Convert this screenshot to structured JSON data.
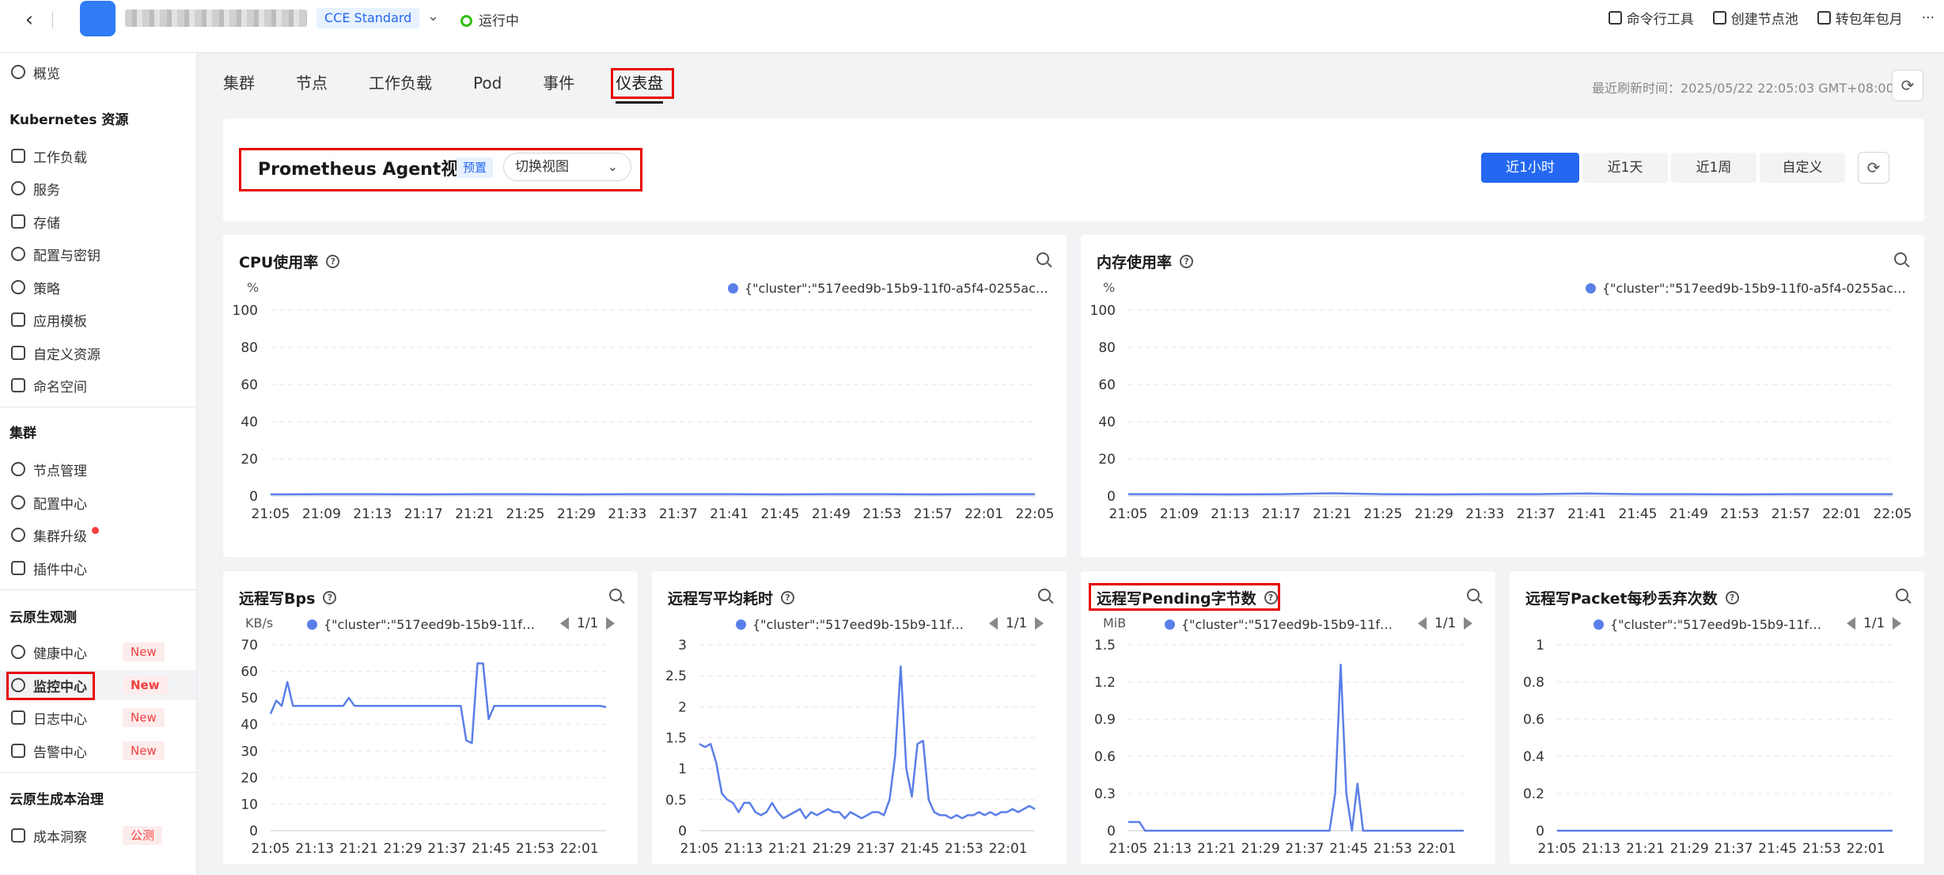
{
  "topbar": {
    "edition_badge": "CCE Standard",
    "status": "运行中",
    "actions": [
      {
        "label": "命令行工具",
        "icon": "terminal-icon"
      },
      {
        "label": "创建节点池",
        "icon": "node-pool-icon"
      },
      {
        "label": "转包年包月",
        "icon": "calendar-icon"
      },
      {
        "label": "···",
        "icon": "more-icon"
      }
    ]
  },
  "sidebar": {
    "overview": "概览",
    "k8s_header": "Kubernetes 资源",
    "k8s_items": [
      "工作负载",
      "服务",
      "存储",
      "配置与密钥",
      "策略",
      "应用模板",
      "自定义资源",
      "命名空间"
    ],
    "cluster_header": "集群",
    "cluster_items": [
      "节点管理",
      "配置中心",
      "集群升级",
      "插件中心"
    ],
    "obs_header": "云原生观测",
    "obs_items": [
      "健康中心",
      "监控中心",
      "日志中心",
      "告警中心"
    ],
    "new_badge": "New",
    "cost_header": "云原生成本治理",
    "cost_items": [
      "成本洞察"
    ],
    "beta_badge": "公测"
  },
  "tabs": [
    "集群",
    "节点",
    "工作负载",
    "Pod",
    "事件",
    "仪表盘"
  ],
  "active_tab": "仪表盘",
  "refresh_time": "最近刷新时间：2025/05/22 22:05:03 GMT+08:00",
  "dashboard": {
    "title": "Prometheus Agent视图",
    "preset_badge": "预置",
    "switch_view": "切换视图",
    "time_ranges": [
      "近1小时",
      "近1天",
      "近1周",
      "自定义"
    ],
    "active_range": "近1小时"
  },
  "legend_label": "{\"cluster\":\"517eed9b-15b9-11f0-a5f4-0255ac10...",
  "legend_label_short": "{\"cluster\":\"517eed9b-15b9-11f0-a5f4",
  "pager": "1/1",
  "colors": {
    "accent": "#2468f2",
    "series": "#5b7fe8",
    "highlight": "#e80000"
  },
  "chart_data": [
    {
      "id": "cpu",
      "type": "line",
      "title": "CPU使用率",
      "unit": "%",
      "ylim": [
        0,
        100
      ],
      "yticks": [
        "100",
        "80",
        "60",
        "40",
        "20",
        "0"
      ],
      "xticks": [
        "21:05",
        "21:09",
        "21:13",
        "21:17",
        "21:21",
        "21:25",
        "21:29",
        "21:33",
        "21:37",
        "21:41",
        "21:45",
        "21:49",
        "21:53",
        "21:57",
        "22:01",
        "22:05"
      ],
      "series": [
        {
          "name": "{\"cluster\":\"517eed9b-15b9-11f0-a5f4-0255ac10...",
          "values": [
            0.9,
            1,
            1,
            0.9,
            1,
            1,
            0.9,
            1,
            1,
            1,
            0.9,
            1,
            1,
            0.9,
            1,
            1
          ]
        }
      ]
    },
    {
      "id": "mem",
      "type": "line",
      "title": "内存使用率",
      "unit": "%",
      "ylim": [
        0,
        100
      ],
      "yticks": [
        "100",
        "80",
        "60",
        "40",
        "20",
        "0"
      ],
      "xticks": [
        "21:05",
        "21:09",
        "21:13",
        "21:17",
        "21:21",
        "21:25",
        "21:29",
        "21:33",
        "21:37",
        "21:41",
        "21:45",
        "21:49",
        "21:53",
        "21:57",
        "22:01",
        "22:05"
      ],
      "series": [
        {
          "name": "{\"cluster\":\"517eed9b-15b9-11f0-a5f4-0255ac10...",
          "values": [
            1,
            1,
            0.9,
            1,
            1.5,
            1,
            0.9,
            1,
            1,
            1.4,
            1,
            1,
            0.9,
            1,
            1,
            1
          ]
        }
      ]
    },
    {
      "id": "bps",
      "type": "line",
      "title": "远程写Bps",
      "unit": "KB/s",
      "ylim": [
        0,
        70
      ],
      "yticks": [
        "70",
        "60",
        "50",
        "40",
        "30",
        "20",
        "10",
        "0"
      ],
      "xticks": [
        "21:05",
        "21:13",
        "21:21",
        "21:29",
        "21:37",
        "21:45",
        "21:53",
        "22:01"
      ],
      "x": [
        0,
        1,
        2,
        3,
        4,
        5,
        6,
        7,
        8,
        9,
        10,
        11,
        12,
        13,
        14,
        15,
        16,
        17,
        18,
        19,
        20,
        21,
        22,
        23,
        24,
        25,
        26,
        27,
        28,
        29,
        30,
        31,
        32,
        33,
        34,
        35,
        36,
        37,
        38,
        39,
        40,
        41,
        42,
        43,
        44,
        45,
        46,
        47,
        48,
        49,
        50,
        51,
        52,
        53,
        54,
        55,
        56,
        57,
        58,
        59,
        60
      ],
      "series": [
        {
          "name": "{\"cluster\":\"517eed9b-15b9-11f0-a5f4",
          "values": [
            44,
            49,
            47,
            56,
            47,
            47,
            47,
            47,
            47,
            47,
            47,
            47,
            47,
            47,
            50,
            47,
            47,
            47,
            47,
            47,
            47,
            47,
            47,
            47,
            47,
            47,
            47,
            47,
            47,
            47,
            47,
            47,
            47,
            47,
            47,
            34,
            33,
            63,
            63,
            42,
            47,
            47,
            47,
            47,
            47,
            47,
            47,
            47,
            47,
            47,
            47,
            47,
            47,
            47,
            47,
            47,
            47,
            47,
            47,
            47,
            46.5
          ]
        }
      ]
    },
    {
      "id": "latency",
      "type": "line",
      "title": "远程写平均耗时",
      "unit": "",
      "ylim": [
        0,
        3
      ],
      "yticks": [
        "3",
        "2.5",
        "2",
        "1.5",
        "1",
        "0.5",
        "0"
      ],
      "xticks": [
        "21:05",
        "21:13",
        "21:21",
        "21:29",
        "21:37",
        "21:45",
        "21:53",
        "22:01"
      ],
      "x": [
        0,
        1,
        2,
        3,
        4,
        5,
        6,
        7,
        8,
        9,
        10,
        11,
        12,
        13,
        14,
        15,
        16,
        17,
        18,
        19,
        20,
        21,
        22,
        23,
        24,
        25,
        26,
        27,
        28,
        29,
        30,
        31,
        32,
        33,
        34,
        35,
        36,
        37,
        38,
        39,
        40,
        41,
        42,
        43,
        44,
        45,
        46,
        47,
        48,
        49,
        50,
        51,
        52,
        53,
        54,
        55,
        56,
        57,
        58,
        59,
        60
      ],
      "series": [
        {
          "name": "{\"cluster\":\"517eed9b-15b9-11f0-a5f4",
          "values": [
            1.4,
            1.35,
            1.4,
            1.1,
            0.6,
            0.5,
            0.45,
            0.3,
            0.45,
            0.45,
            0.3,
            0.25,
            0.3,
            0.45,
            0.3,
            0.2,
            0.25,
            0.3,
            0.35,
            0.2,
            0.3,
            0.25,
            0.3,
            0.35,
            0.3,
            0.3,
            0.2,
            0.3,
            0.25,
            0.2,
            0.25,
            0.3,
            0.3,
            0.25,
            0.5,
            1.2,
            2.65,
            1.0,
            0.55,
            1.4,
            1.45,
            0.5,
            0.3,
            0.25,
            0.25,
            0.2,
            0.25,
            0.2,
            0.25,
            0.25,
            0.3,
            0.25,
            0.3,
            0.25,
            0.3,
            0.3,
            0.35,
            0.3,
            0.35,
            0.4,
            0.35
          ]
        }
      ]
    },
    {
      "id": "pending",
      "type": "line",
      "title": "远程写Pending字节数",
      "unit": "MiB",
      "ylim": [
        0,
        1.5
      ],
      "yticks": [
        "1.5",
        "1.2",
        "0.9",
        "0.6",
        "0.3",
        "0"
      ],
      "xticks": [
        "21:05",
        "21:13",
        "21:21",
        "21:29",
        "21:37",
        "21:45",
        "21:53",
        "22:01"
      ],
      "x": [
        0,
        1,
        2,
        3,
        4,
        5,
        6,
        7,
        8,
        9,
        10,
        11,
        12,
        13,
        14,
        15,
        16,
        17,
        18,
        19,
        20,
        21,
        22,
        23,
        24,
        25,
        26,
        27,
        28,
        29,
        30,
        31,
        32,
        33,
        34,
        35,
        36,
        37,
        38,
        39,
        40,
        41,
        42,
        43,
        44,
        45,
        46,
        47,
        48,
        49,
        50,
        51,
        52,
        53,
        54,
        55,
        56,
        57,
        58,
        59,
        60
      ],
      "series": [
        {
          "name": "{\"cluster\":\"517eed9b-15b9-11f0-a5f4",
          "values": [
            0.07,
            0.07,
            0.07,
            0,
            0,
            0,
            0,
            0,
            0,
            0,
            0,
            0,
            0,
            0,
            0,
            0,
            0,
            0,
            0,
            0,
            0,
            0,
            0,
            0,
            0,
            0,
            0,
            0,
            0,
            0,
            0,
            0,
            0,
            0,
            0,
            0,
            0,
            0.3,
            1.34,
            0.3,
            0,
            0.38,
            0,
            0,
            0,
            0,
            0,
            0,
            0,
            0,
            0,
            0,
            0,
            0,
            0,
            0,
            0,
            0,
            0,
            0,
            0
          ]
        }
      ]
    },
    {
      "id": "dropped",
      "type": "line",
      "title": "远程写Packet每秒丢弃次数",
      "unit": "",
      "ylim": [
        0,
        1
      ],
      "yticks": [
        "1",
        "0.8",
        "0.6",
        "0.4",
        "0.2",
        "0"
      ],
      "xticks": [
        "21:05",
        "21:13",
        "21:21",
        "21:29",
        "21:37",
        "21:45",
        "21:53",
        "22:01"
      ],
      "series": [
        {
          "name": "{\"cluster\":\"517eed9b-15b9-11f0-a5f4",
          "values": [
            0,
            0,
            0,
            0,
            0,
            0,
            0,
            0,
            0,
            0
          ]
        }
      ]
    }
  ]
}
